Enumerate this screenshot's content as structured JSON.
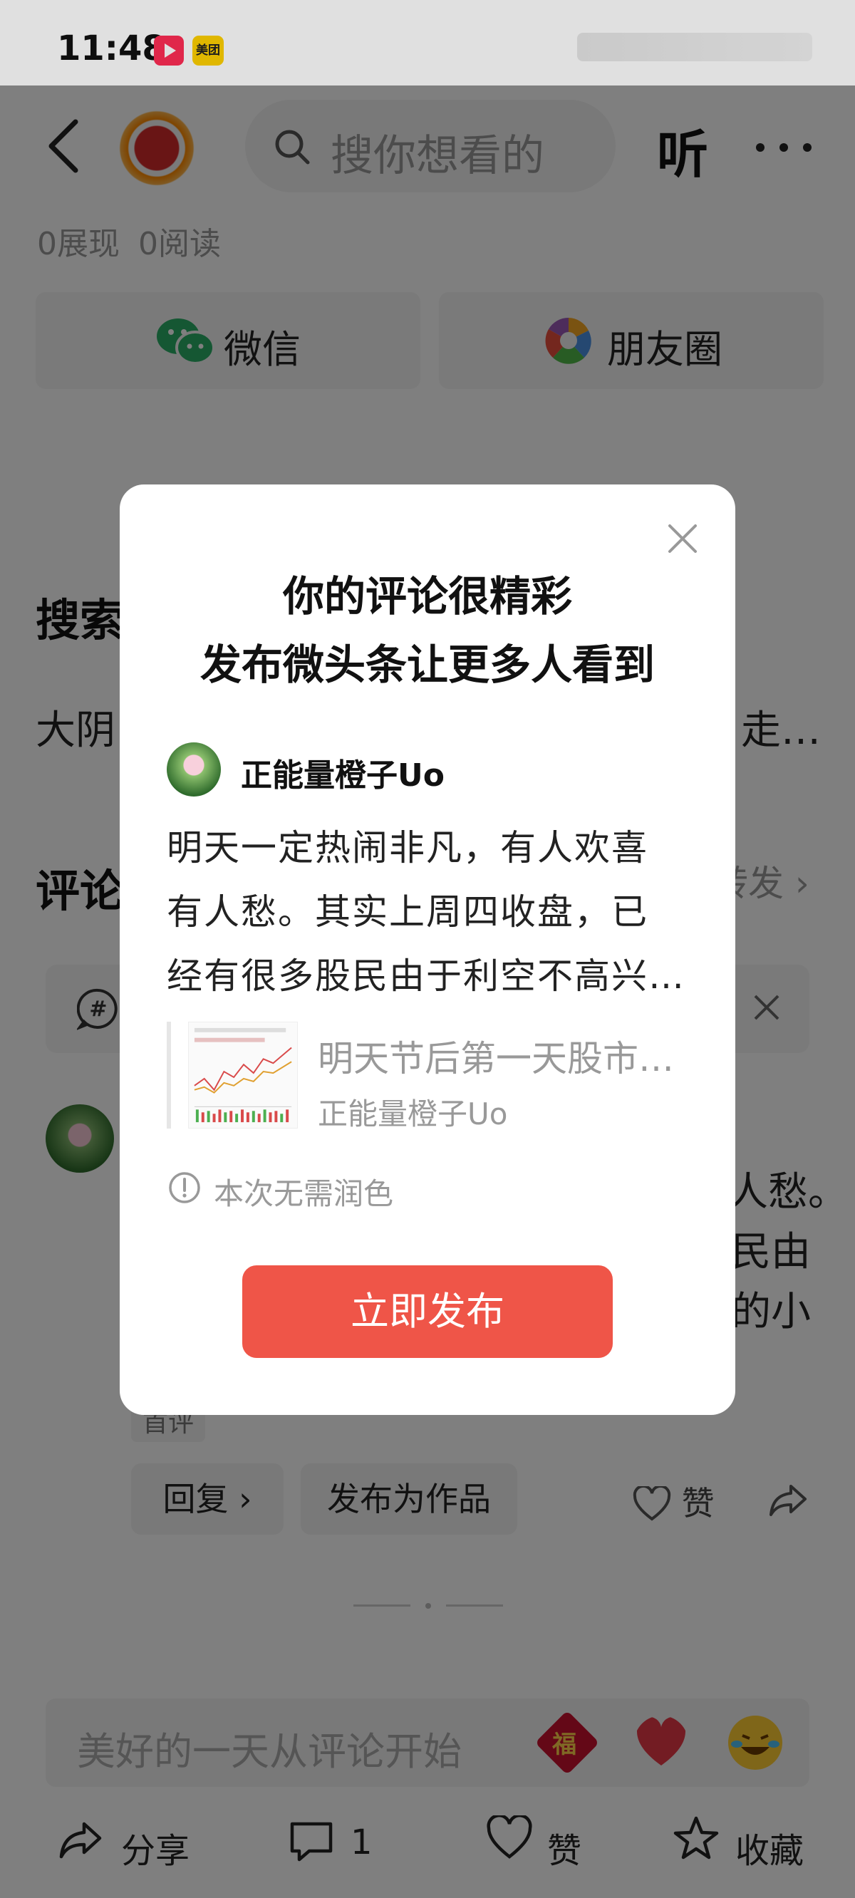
{
  "status_bar": {
    "time": "11:48",
    "app2_label": "美团"
  },
  "header": {
    "search_placeholder": "搜你想看的",
    "listen_label": "听"
  },
  "stats": {
    "views": "0展现",
    "reads": "0阅读"
  },
  "share": {
    "wechat_label": "微信",
    "moments_label": "朋友圈"
  },
  "background": {
    "search_section_title": "搜索",
    "search_row_head": "大阴",
    "search_row_tail": "走…",
    "comments_title": "评论",
    "forward_label": "转发",
    "comment_tail_1": "人愁。",
    "comment_tail_2": "民由",
    "comment_tail_3": "的小",
    "comment_tag": "首评",
    "reply_label": "回复",
    "publish_as_work_label": "发布为作品",
    "like_label": "赞"
  },
  "input_bar": {
    "placeholder": "美好的一天从评论开始",
    "fu_char": "福"
  },
  "bottom_bar": {
    "share_label": "分享",
    "comment_count": "1",
    "like_label": "赞",
    "favorite_label": "收藏"
  },
  "modal": {
    "title_line1": "你的评论很精彩",
    "title_line2": "发布微头条让更多人看到",
    "username": "正能量橙子Uo",
    "content_line1": "明天一定热闹非凡，有人欢喜",
    "content_line2": "有人愁。其实上周四收盘，已",
    "content_line3": "经有很多股民由于利空不高兴…",
    "quote_title": "明天节后第一天股市…",
    "quote_author": "正能量橙子Uo",
    "notice": "本次无需润色",
    "publish_button": "立即发布"
  },
  "colors": {
    "accent": "#ef5548",
    "overlay": "rgba(0,0,0,0.5)",
    "wechat_green": "#2aae67"
  },
  "icons": [
    "back-icon",
    "search-icon",
    "more-icon",
    "wechat-icon",
    "moments-icon",
    "hash-icon",
    "close-icon",
    "share-icon",
    "comment-icon",
    "heart-icon",
    "star-icon",
    "info-icon"
  ]
}
